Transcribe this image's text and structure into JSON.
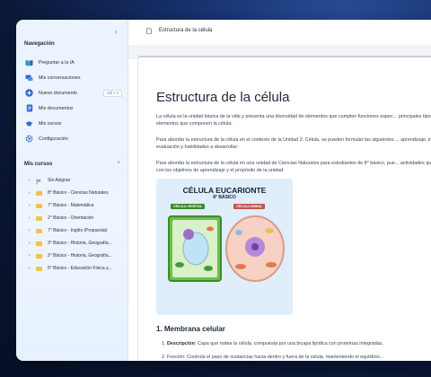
{
  "sidebar": {
    "nav_title": "Navegación",
    "nav_items": [
      {
        "label": "Preguntar a la IA",
        "icon": "book-icon"
      },
      {
        "label": "Mis conversaciones",
        "icon": "chat-icon"
      },
      {
        "label": "Nuevo documento",
        "icon": "plus-circle-icon",
        "shortcut": "ctrl + n"
      },
      {
        "label": "Mis documentos",
        "icon": "document-icon"
      },
      {
        "label": "Mis cursos",
        "icon": "graduation-cap-icon"
      },
      {
        "label": "Configuración",
        "icon": "gear-icon"
      }
    ],
    "courses_title": "Mis cursos",
    "courses": [
      "Sin Asignar",
      "8° Básico - Ciencias Naturales",
      "7° Básico - Matemática",
      "2° Básico - Orientación",
      "7° Básico - Inglés (Propuesta)",
      "3° Básico - Historia, Geografía...",
      "2° Básico - Historia, Geografía...",
      "6° Básico - Educación Física y..."
    ]
  },
  "breadcrumb": "Estructura de la célula",
  "document": {
    "title": "Estructura de la célula",
    "para1": "La célula es la unidad básica de la vida y presenta una diversidad de elementos que cumplen funciones espec... principales tipos de elementos que componen la célula:",
    "para2": "Para abordar la estructura de la célula en el contexto de la Unidad 2: Célula, se pueden formular las siguientes ... aprendizaje, indicadores de evaluación y habilidades a desarrollar:",
    "para3": "Para abordar la estructura de la célula en una unidad de Ciencias Naturales para estudiantes de 8° básico, pue... actividades que se alineen con los objetivos de aprendizaje y el propósito de la unidad:",
    "figure": {
      "title": "CÉLULA EUCARIONTE",
      "subtitle": "8° BÁSICO",
      "left_label": "CÉLULA VEGETAL",
      "right_label": "CÉLULA ANIMAL"
    },
    "section_heading": "1. Membrana celular",
    "list_item_1_term": "Descripción",
    "list_item_1_text": ": Capa que rodea la célula, compuesta por una bicapa lipídica con proteínas integradas.",
    "list_item_2_text": "2. Función: Controla el paso de sustancias hacia dentro y fuera de la célula, manteniendo el equilibrio..."
  },
  "colors": {
    "sidebar_bg": "#eaf3ff",
    "accent": "#2b6cd8",
    "folder": "#f2c14e"
  }
}
